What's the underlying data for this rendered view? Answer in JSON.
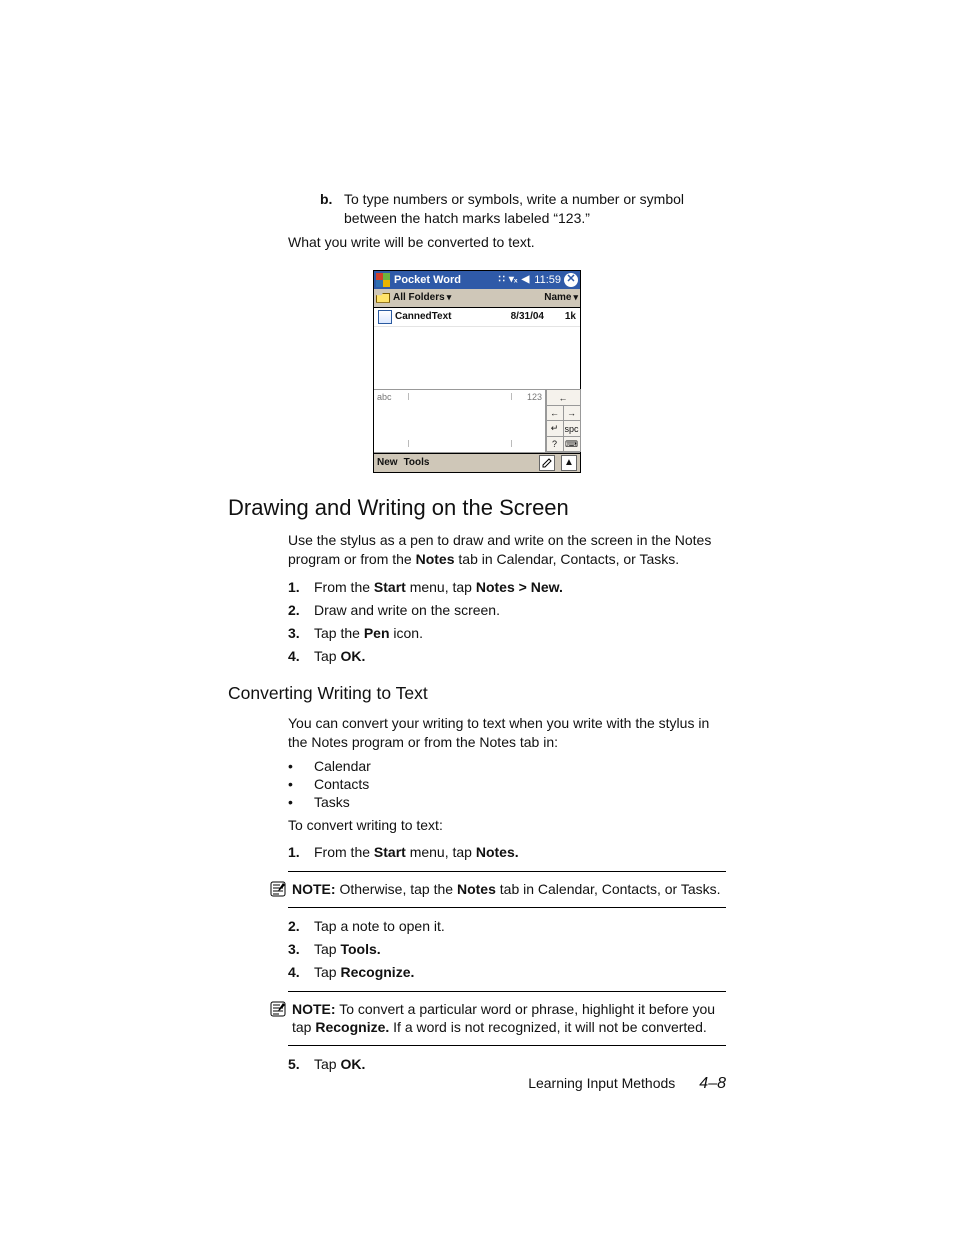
{
  "step_b": {
    "label": "b.",
    "text_before": "To type numbers or symbols, write a number or symbol between the hatch marks labeled “123.”"
  },
  "after_step": "What you write will be converted to text.",
  "device": {
    "title": "Pocket Word",
    "time": "11:59",
    "folder_label": "All Folders",
    "name_label": "Name",
    "file": {
      "name": "CannedText",
      "date": "8/31/04",
      "size": "1k"
    },
    "input": {
      "abc": "abc",
      "n123": "123"
    },
    "side": {
      "bksp": "←",
      "left": "←",
      "right": "→",
      "enter": "↵",
      "spc": "spc",
      "q": "?",
      "kb": "⌨"
    },
    "bottom": {
      "new": "New",
      "tools": "Tools",
      "up": "▲"
    }
  },
  "h2": "Drawing and Writing on the Screen",
  "p_draw_1a": "Use the stylus as a pen to draw and write on the screen in the Notes program or from the ",
  "p_draw_1b_bold": "Notes",
  "p_draw_1c": " tab in Calendar, Contacts, or Tasks.",
  "ol_draw": [
    {
      "n": "1.",
      "a": "From the ",
      "b1": "Start",
      "c": " menu, tap ",
      "b2": "Notes > New."
    },
    {
      "n": "2.",
      "a": "Draw and write on the screen."
    },
    {
      "n": "3.",
      "a": "Tap the ",
      "b1": "Pen",
      "c": " icon."
    },
    {
      "n": "4.",
      "a": "Tap ",
      "b1": "OK."
    }
  ],
  "h3": "Converting Writing to Text",
  "p_conv": "You can convert your writing to text when you write with the stylus in the Notes program or from the Notes tab in:",
  "ul_conv": [
    "Calendar",
    "Contacts",
    "Tasks"
  ],
  "p_toconv": "To convert writing to text:",
  "ol_conv1": [
    {
      "n": "1.",
      "a": "From the ",
      "b1": "Start",
      "c": " menu, tap ",
      "b2": "Notes."
    }
  ],
  "note1": {
    "lead": "NOTE:",
    "a": " Otherwise, tap the ",
    "b1": "Notes",
    "c": " tab in Calendar, Contacts, or Tasks."
  },
  "ol_conv2": [
    {
      "n": "2.",
      "a": "Tap a note to open it."
    },
    {
      "n": "3.",
      "a": "Tap ",
      "b1": "Tools."
    },
    {
      "n": "4.",
      "a": "Tap ",
      "b1": "Recognize."
    }
  ],
  "note2": {
    "lead": "NOTE:",
    "a": " To convert a particular word or phrase, highlight it before you tap ",
    "b1": "Recognize.",
    "c": " If a word is not recognized, it will not be converted."
  },
  "ol_conv3": [
    {
      "n": "5.",
      "a": "Tap ",
      "b1": "OK."
    }
  ],
  "footer": {
    "chapter": "Learning Input Methods",
    "page": "4–8"
  }
}
